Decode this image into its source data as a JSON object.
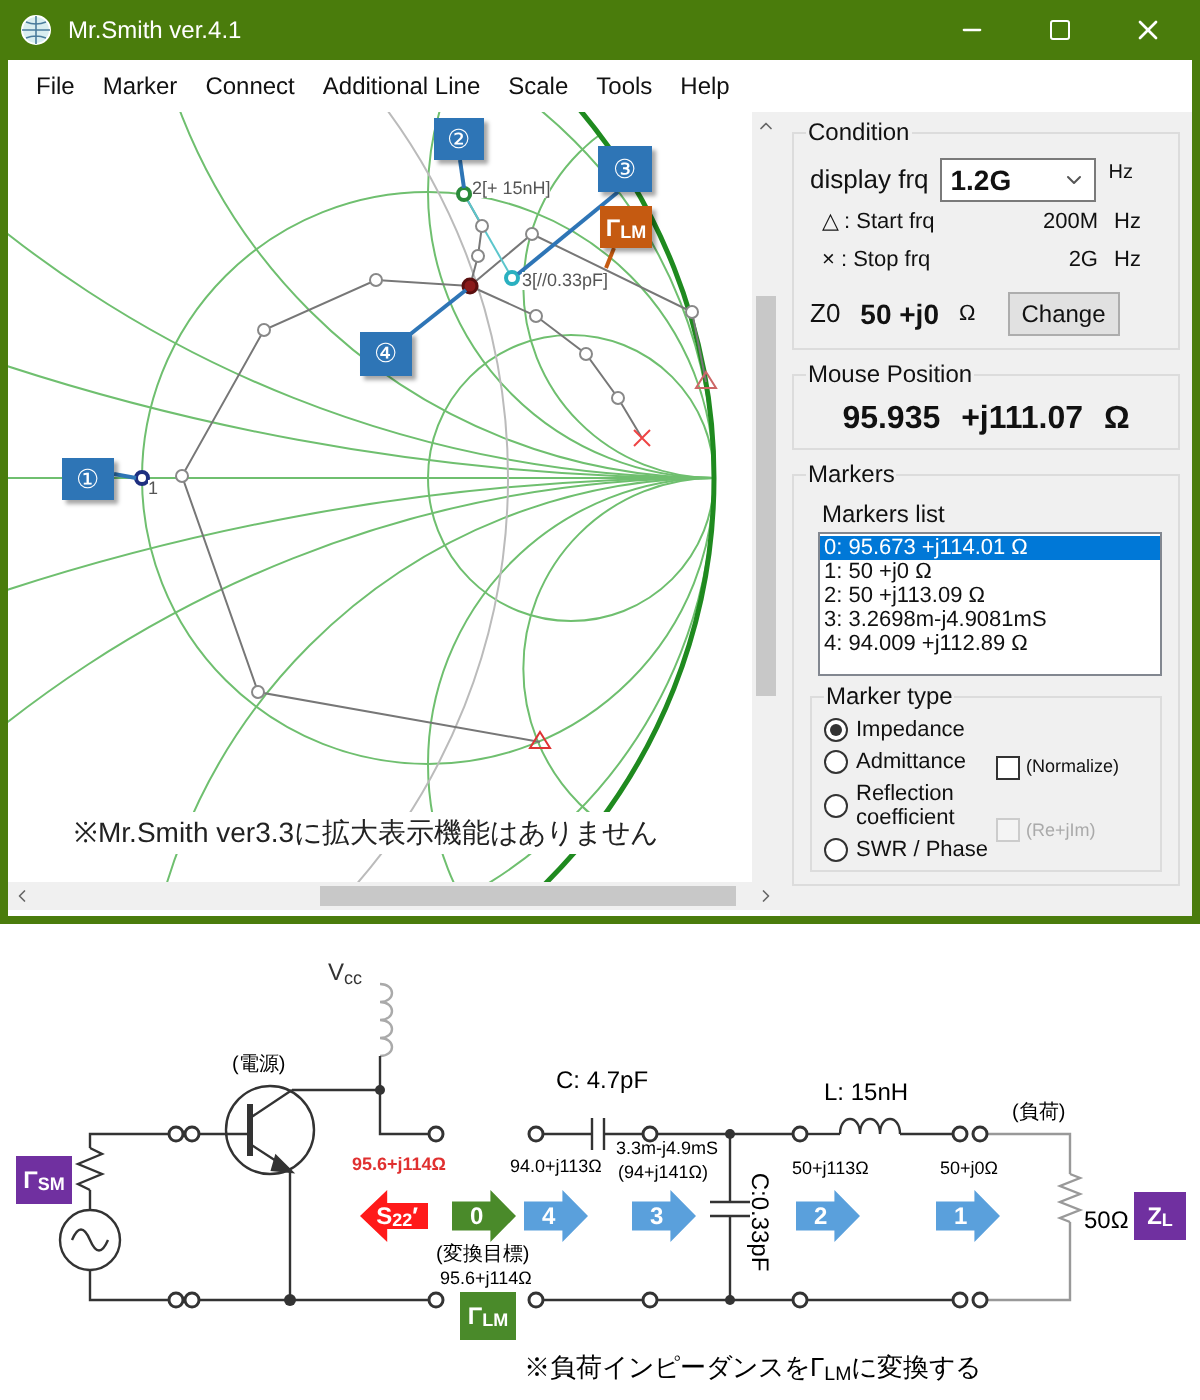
{
  "window": {
    "title": "Mr.Smith ver.4.1"
  },
  "menu": [
    {
      "label": "File"
    },
    {
      "label": "Marker"
    },
    {
      "label": "Connect"
    },
    {
      "label": "Additional Line"
    },
    {
      "label": "Scale"
    },
    {
      "label": "Tools"
    },
    {
      "label": "Help"
    }
  ],
  "smith_chart": {
    "callouts": [
      {
        "label": "①",
        "kind": "marker"
      },
      {
        "label": "②",
        "kind": "marker"
      },
      {
        "label": "③",
        "kind": "marker"
      },
      {
        "label": "④",
        "kind": "marker"
      },
      {
        "label": "Γ$_{LM}$",
        "kind": "target"
      }
    ],
    "point_labels": [
      "1",
      "2[+ 15nH]",
      "3[//0.33pF]"
    ],
    "note": "※Mr.Smith ver3.3に拡大表示機能はありません"
  },
  "condition": {
    "title": "Condition",
    "display_frq_label": "display frq",
    "display_frq": "1.2G",
    "display_frq_unit": "Hz",
    "start": {
      "label": "△ : Start frq",
      "value": "200M",
      "unit": "Hz"
    },
    "stop": {
      "label": "× : Stop frq",
      "value": "2G",
      "unit": "Hz"
    },
    "z0_label": "Z0",
    "z0": "50 +j0",
    "z0_unit": "Ω",
    "change_button": "Change"
  },
  "mouse_position": {
    "title": "Mouse Position",
    "value": "95.935 +j111.07 Ω"
  },
  "markers": {
    "title": "Markers",
    "list_title": "Markers list",
    "items": [
      {
        "text": "0: 95.673 +j114.01 Ω",
        "selected": true
      },
      {
        "text": "1: 50 +j0 Ω",
        "selected": false
      },
      {
        "text": "2: 50 +j113.09 Ω",
        "selected": false
      },
      {
        "text": "3: 3.2698m-j4.9081mS",
        "selected": false
      },
      {
        "text": "4: 94.009 +j112.89 Ω",
        "selected": false
      }
    ],
    "marker_type": {
      "title": "Marker type",
      "options": [
        {
          "label": "Impedance",
          "selected": true
        },
        {
          "label": "Admittance",
          "selected": false
        },
        {
          "label": "Reflection coefficient",
          "selected": false
        },
        {
          "label": "SWR / Phase",
          "selected": false
        }
      ],
      "checkboxes": [
        {
          "label": "(Normalize)",
          "checked": false,
          "disabled": false
        },
        {
          "label": "(Re+jIm)",
          "checked": false,
          "disabled": true
        }
      ]
    }
  },
  "circuit": {
    "vcc": "V$_{cc}$",
    "supply_label": "(電源)",
    "source_badge": "Γ$_{SM}$",
    "output_impedance": "95.6+j114Ω",
    "arrows": [
      {
        "label": "S$_{22}$′",
        "kind": "reverse"
      },
      {
        "label": "0",
        "kind": "target"
      },
      {
        "label": "4",
        "kind": "step"
      },
      {
        "label": "3",
        "kind": "step"
      },
      {
        "label": "2",
        "kind": "step"
      },
      {
        "label": "1",
        "kind": "step"
      }
    ],
    "target_label": "(変換目標)",
    "target_impedance": "95.6+j114Ω",
    "match_badge": "Γ$_{LM}$",
    "series_cap": "C: 4.7pF",
    "impedance_4": "94.0+j113Ω",
    "admittance_3": "3.3m-j4.9mS",
    "impedance_3": "(94+j141Ω)",
    "shunt_cap": "C:0.33pF",
    "inductor": "L: 15nH",
    "impedance_2": "50+j113Ω",
    "impedance_1": "50+j0Ω",
    "load_label": "(負荷)",
    "load_value": "50Ω",
    "load_badge": "Z$_{L}$",
    "note": "※負荷インピーダンスをΓ$_{LM}$に変換する"
  }
}
